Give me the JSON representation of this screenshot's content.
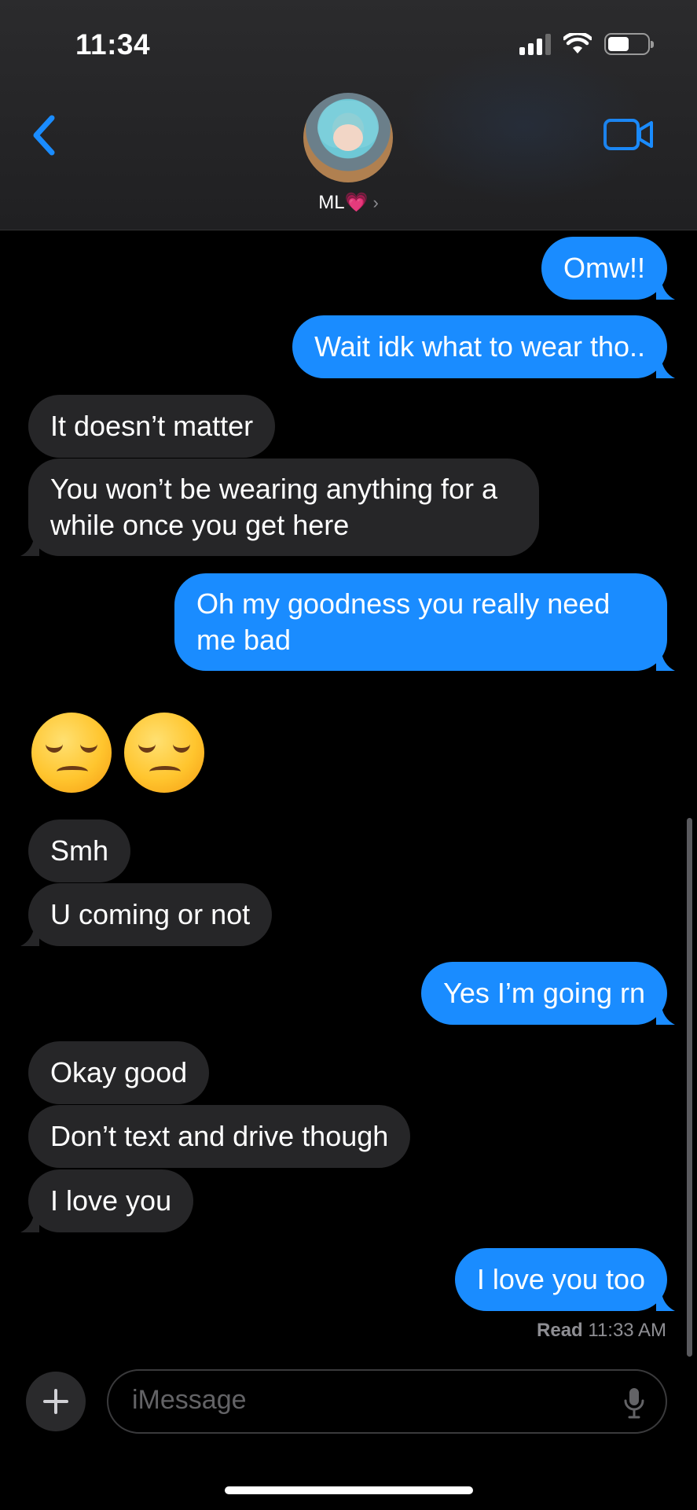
{
  "status_bar": {
    "time": "11:34"
  },
  "header": {
    "contact_name": "ML💗",
    "chevron": "›",
    "back_icon": "chevron-left-icon",
    "video_icon": "video-camera-icon"
  },
  "messages": [
    {
      "side": "sent",
      "text": "Omw!!"
    },
    {
      "side": "sent",
      "text": "Wait idk what to wear tho.."
    },
    {
      "side": "recv",
      "text": "It doesn’t matter"
    },
    {
      "side": "recv",
      "text": "You won’t be wearing anything for a while once you get here"
    },
    {
      "side": "sent",
      "text": "Oh my goodness you really need me bad"
    },
    {
      "side": "sent",
      "text": "😒 😒",
      "emoji": "unamused-face-icon"
    },
    {
      "side": "recv",
      "text": "Smh"
    },
    {
      "side": "recv",
      "text": "U coming or not"
    },
    {
      "side": "sent",
      "text": "Yes I’m going rn"
    },
    {
      "side": "recv",
      "text": "Okay good"
    },
    {
      "side": "recv",
      "text": "Don’t text and drive though"
    },
    {
      "side": "recv",
      "text": "I love you"
    },
    {
      "side": "sent",
      "text": "I love you too"
    }
  ],
  "read_receipt": {
    "label": "Read",
    "time": "11:33 AM"
  },
  "input_bar": {
    "placeholder": "iMessage",
    "plus_icon": "plus-icon",
    "mic_icon": "microphone-icon"
  },
  "colors": {
    "sent_bubble": "#1a8cff",
    "received_bubble": "#262628",
    "background": "#000000",
    "accent": "#1a8cff"
  }
}
